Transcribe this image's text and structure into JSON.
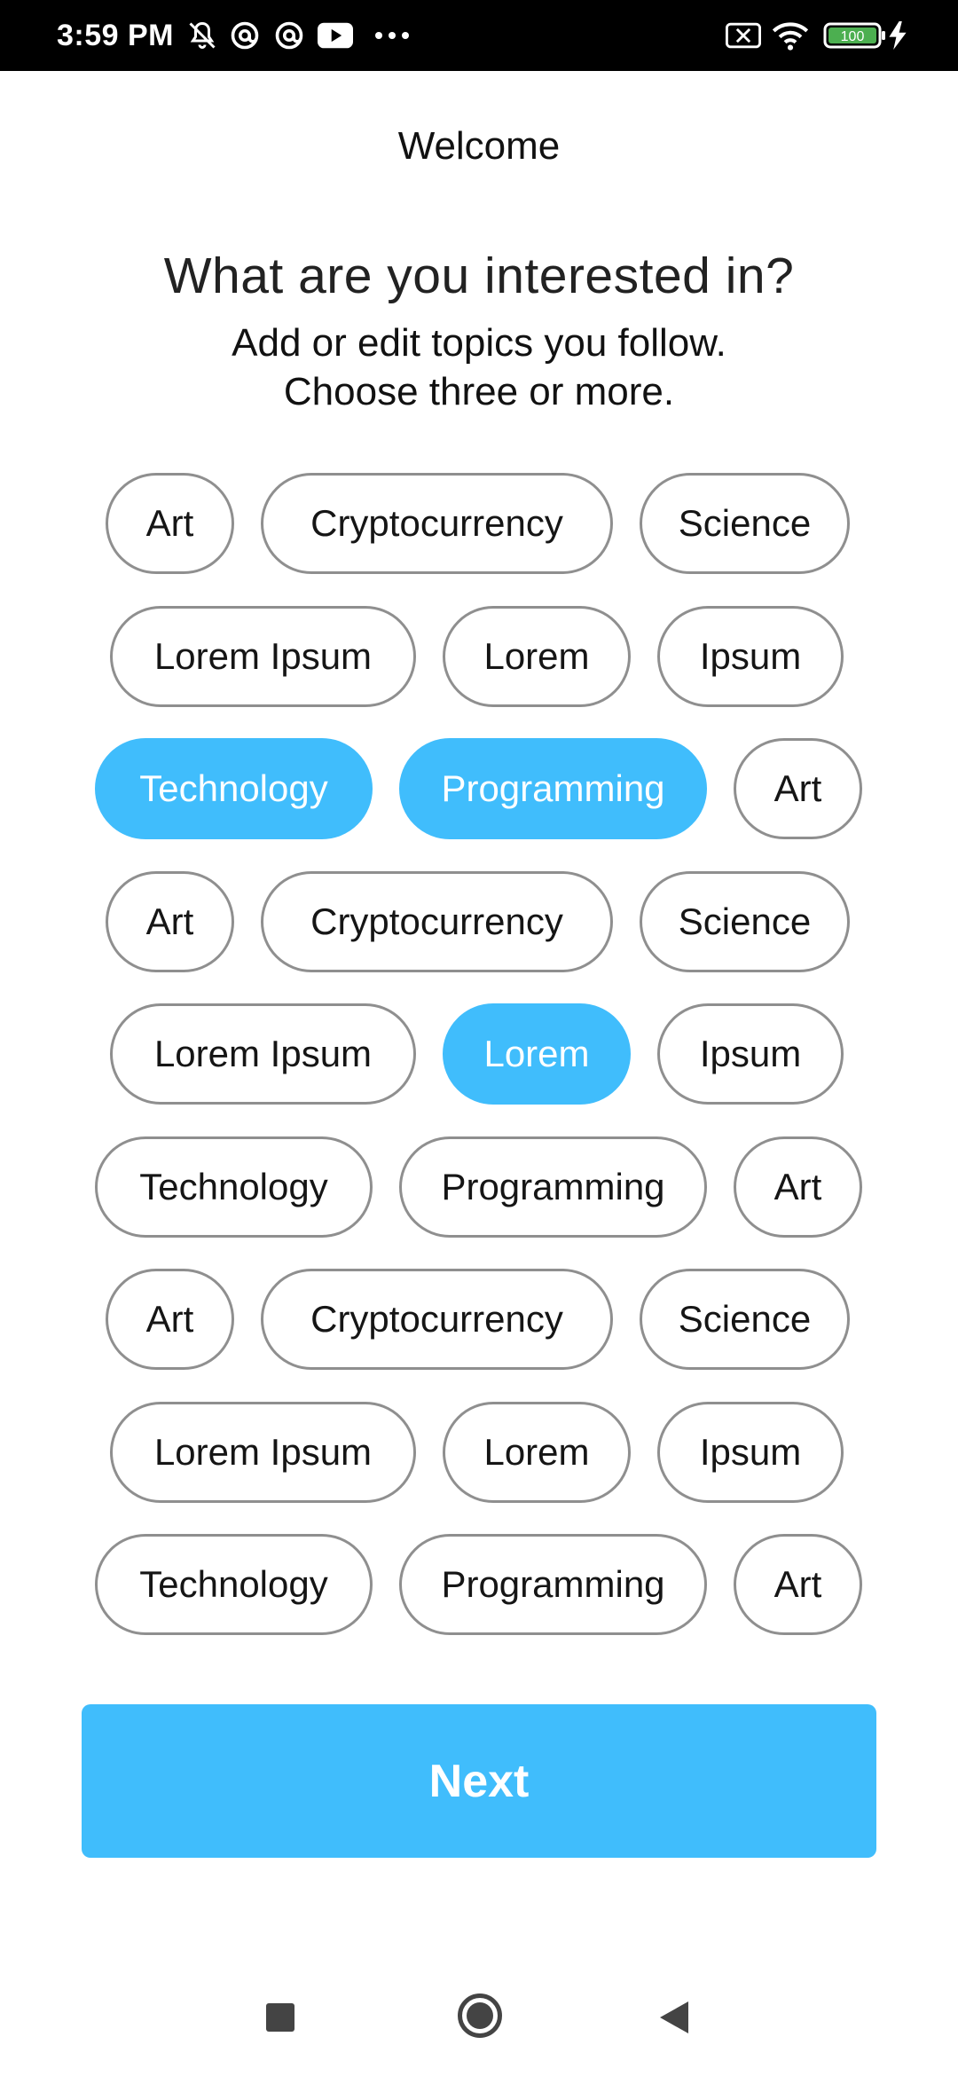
{
  "status_bar": {
    "time": "3:59 PM",
    "battery_level": "100",
    "left_icons": [
      "mute-icon",
      "at-icon",
      "at-icon",
      "youtube-icon",
      "more-dots-icon"
    ],
    "right_icons": [
      "sim-off-icon",
      "wifi-icon",
      "battery-icon",
      "charging-icon"
    ]
  },
  "header": {
    "title": "Welcome",
    "question": "What are you interested in?",
    "subtitle_line1": "Add or edit topics you follow.",
    "subtitle_line2": "Choose three or more."
  },
  "topics": [
    [
      {
        "label": "Art",
        "selected": false
      },
      {
        "label": "Cryptocurrency",
        "selected": false
      },
      {
        "label": "Science",
        "selected": false
      }
    ],
    [
      {
        "label": "Lorem Ipsum",
        "selected": false
      },
      {
        "label": "Lorem",
        "selected": false
      },
      {
        "label": "Ipsum",
        "selected": false
      }
    ],
    [
      {
        "label": "Technology",
        "selected": true
      },
      {
        "label": "Programming",
        "selected": true
      },
      {
        "label": "Art",
        "selected": false
      }
    ],
    [
      {
        "label": "Art",
        "selected": false
      },
      {
        "label": "Cryptocurrency",
        "selected": false
      },
      {
        "label": "Science",
        "selected": false
      }
    ],
    [
      {
        "label": "Lorem Ipsum",
        "selected": false
      },
      {
        "label": "Lorem",
        "selected": true
      },
      {
        "label": "Ipsum",
        "selected": false
      }
    ],
    [
      {
        "label": "Technology",
        "selected": false
      },
      {
        "label": "Programming",
        "selected": false
      },
      {
        "label": "Art",
        "selected": false
      }
    ],
    [
      {
        "label": "Art",
        "selected": false
      },
      {
        "label": "Cryptocurrency",
        "selected": false
      },
      {
        "label": "Science",
        "selected": false
      }
    ],
    [
      {
        "label": "Lorem Ipsum",
        "selected": false
      },
      {
        "label": "Lorem",
        "selected": false
      },
      {
        "label": "Ipsum",
        "selected": false
      }
    ],
    [
      {
        "label": "Technology",
        "selected": false
      },
      {
        "label": "Programming",
        "selected": false
      },
      {
        "label": "Art",
        "selected": false
      }
    ]
  ],
  "next_button": {
    "label": "Next"
  },
  "nav_bar": {
    "icons": [
      "recents-icon",
      "home-icon",
      "back-icon"
    ]
  },
  "colors": {
    "accent": "#40bdfc",
    "chip_border": "#8f8f8f",
    "text": "#151515",
    "status_bar": "#000000",
    "battery_fill": "#4caf50"
  }
}
